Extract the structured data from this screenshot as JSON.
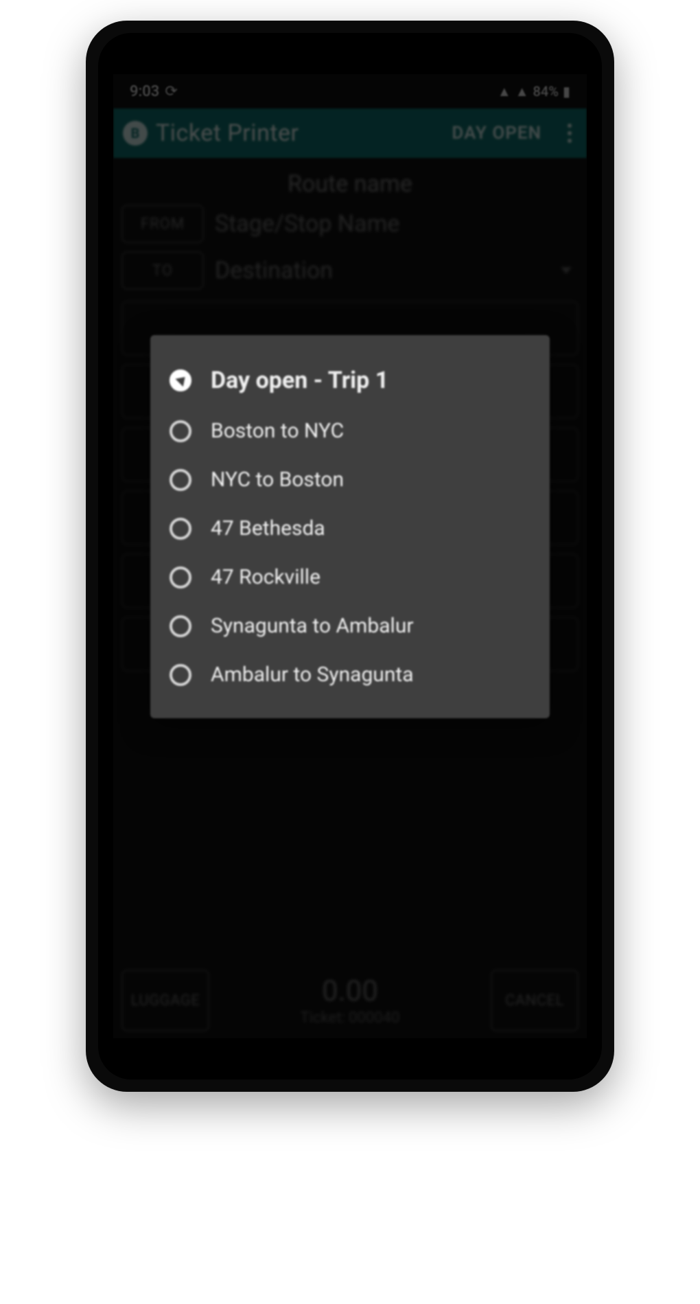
{
  "status": {
    "time": "9:03",
    "battery": "84%"
  },
  "appbar": {
    "title": "Ticket Printer",
    "day_open_label": "DAY OPEN"
  },
  "main": {
    "route_name": "Route name",
    "from_label": "FROM",
    "from_value": "Stage/Stop Name",
    "to_label": "TO",
    "to_value": "Destination"
  },
  "bottom": {
    "luggage_label": "LUGGAGE",
    "cancel_label": "CANCEL",
    "amount": "0.00",
    "ticket_label": "Ticket: 000040"
  },
  "dialog": {
    "options": [
      {
        "label": "Day open - Trip 1",
        "selected": true
      },
      {
        "label": "Boston to NYC",
        "selected": false
      },
      {
        "label": "NYC to Boston",
        "selected": false
      },
      {
        "label": "47 Bethesda",
        "selected": false
      },
      {
        "label": "47 Rockville",
        "selected": false
      },
      {
        "label": "Synagunta to Ambalur",
        "selected": false
      },
      {
        "label": "Ambalur to Synagunta",
        "selected": false
      }
    ]
  }
}
